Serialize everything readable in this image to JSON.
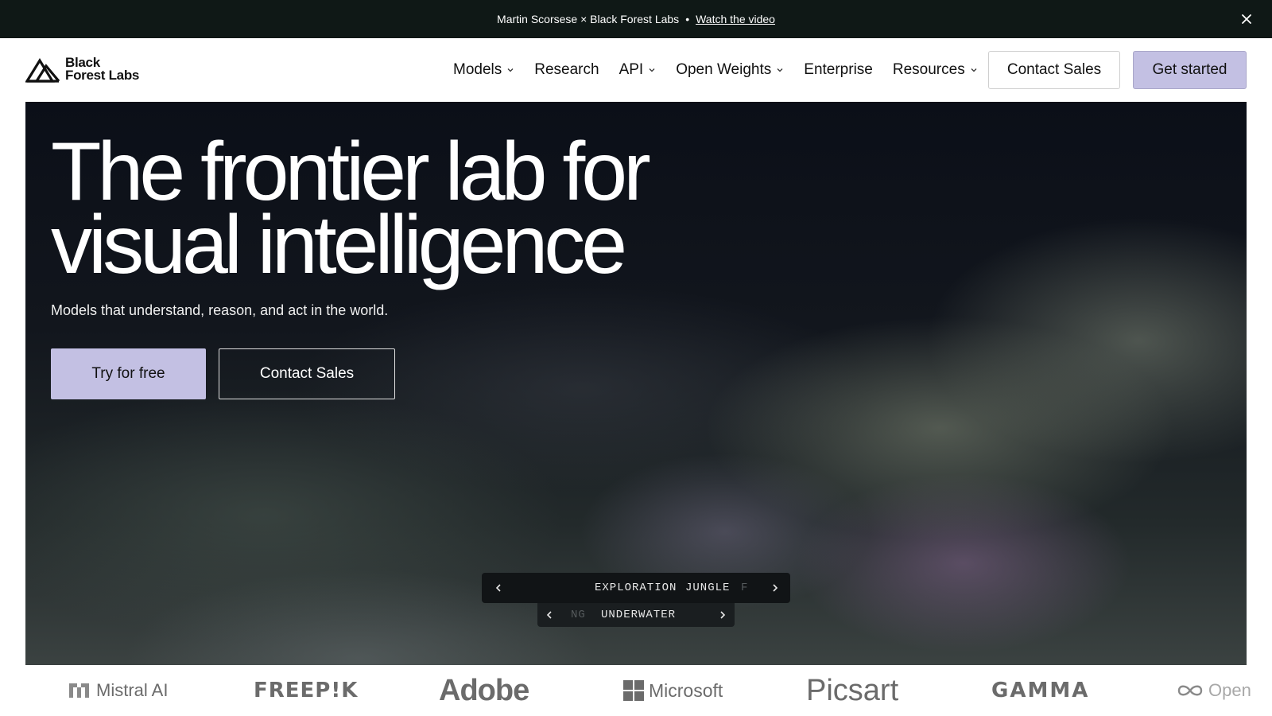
{
  "announcement": {
    "text": "Martin Scorsese × Black Forest Labs",
    "separator": "•",
    "link": "Watch the video",
    "close_icon": "close-icon"
  },
  "nav": {
    "logo_line1": "Black",
    "logo_line2": "Forest Labs",
    "items": [
      {
        "label": "Models",
        "dropdown": true
      },
      {
        "label": "Research",
        "dropdown": false
      },
      {
        "label": "API",
        "dropdown": true
      },
      {
        "label": "Open Weights",
        "dropdown": true
      },
      {
        "label": "Enterprise",
        "dropdown": false
      },
      {
        "label": "Resources",
        "dropdown": true
      }
    ],
    "contact_sales": "Contact Sales",
    "get_started": "Get started"
  },
  "hero": {
    "title_line1": "The frontier lab for",
    "title_line2": "visual intelligence",
    "subtitle": "Models that understand, reason, and act in the world.",
    "try_button": "Try for free",
    "contact_button": "Contact Sales",
    "carousel_top": {
      "active": "EXPLORATION",
      "next": "JUNGLE",
      "peek": "F"
    },
    "carousel_bottom": {
      "peek": "NG",
      "active": "UNDERWATER"
    }
  },
  "partners": [
    "Mistral AI",
    "FREEP!K",
    "Adobe",
    "Microsoft",
    "Picsart",
    "GAMMA",
    "Open"
  ],
  "colors": {
    "announcement_bg": "#0f1816",
    "accent_lavender": "#c3c0e3",
    "partner_gray": "#6b6b6b"
  }
}
